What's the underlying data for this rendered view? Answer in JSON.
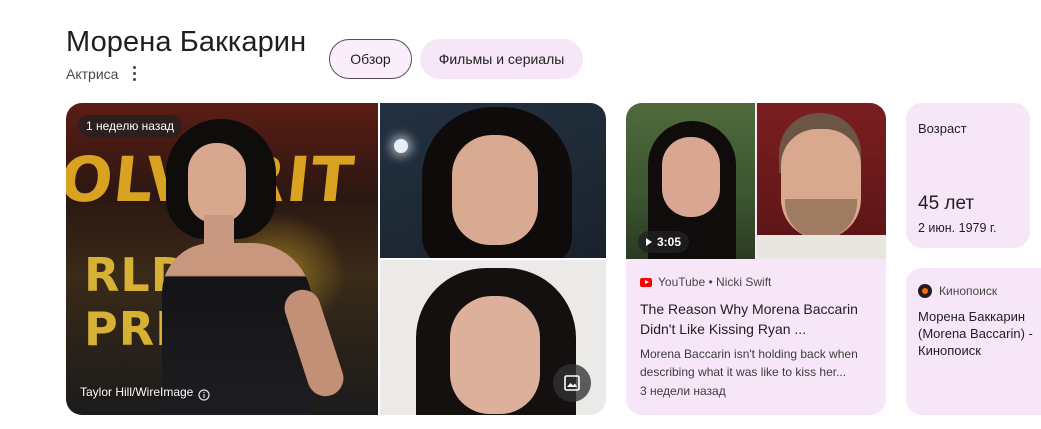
{
  "header": {
    "title": "Морена Баккарин",
    "subtitle": "Актриса"
  },
  "chips": {
    "overview": "Обзор",
    "films": "Фильмы и сериалы"
  },
  "photos": {
    "main_badge": "1 неделю назад",
    "main_sign_top": "OLVERIT",
    "main_sign_bottom": "RLD PREMIER",
    "main_credit": "Taylor Hill/WireImage",
    "image_button_icon": "image-icon"
  },
  "video": {
    "duration": "3:05",
    "source": "YouTube • Nicki Swift",
    "title": "The Reason Why Morena Baccarin Didn't Like Kissing Ryan ...",
    "description": "Morena Baccarin isn't holding back when describing what it was like to kiss her...",
    "date": "3 недели назад"
  },
  "age": {
    "label": "Возраст",
    "value": "45 лет",
    "birth": "2 июн. 1979 г."
  },
  "kinopoisk": {
    "source": "Кинопоиск",
    "text": "Морена Баккарин (Morena Baccarin) - Кинопоиск"
  },
  "colors": {
    "chip_bg": "#f7e6f7",
    "chip_border": "#5b4a63",
    "card_bg": "#f7e6f7",
    "youtube_red": "#ff0000"
  }
}
